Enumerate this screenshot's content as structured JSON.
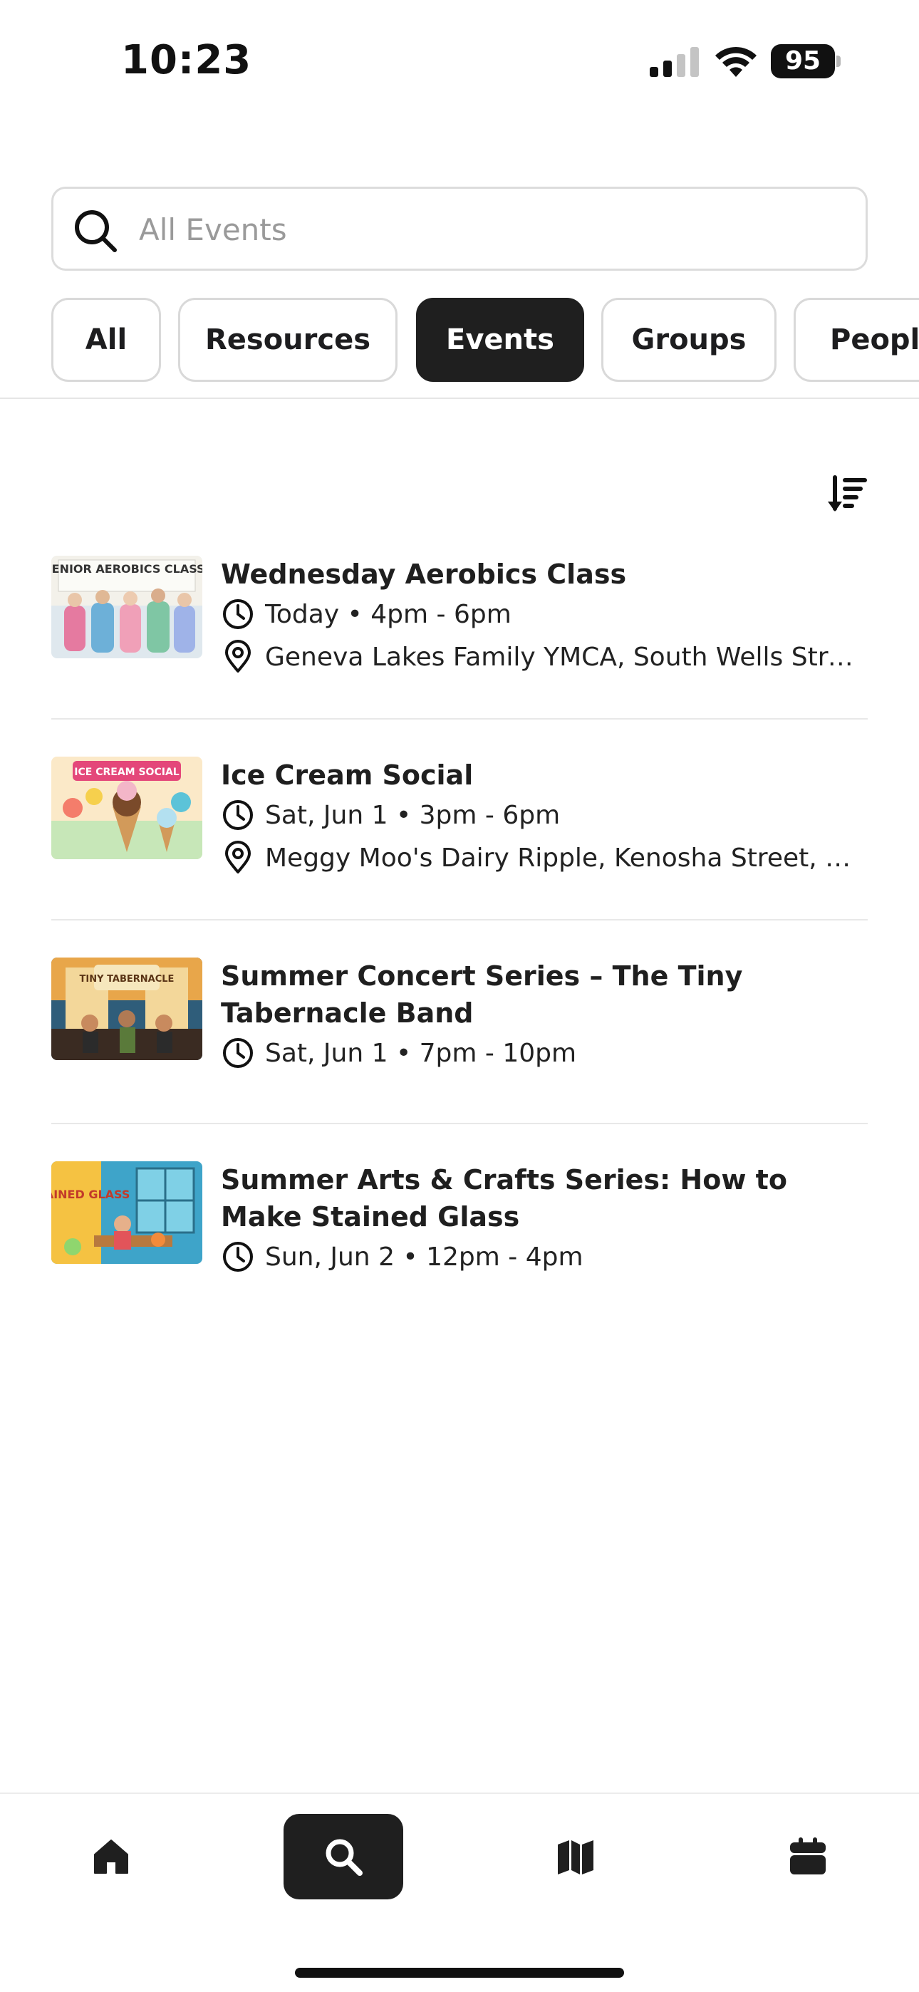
{
  "status_bar": {
    "time": "10:23",
    "battery": "95"
  },
  "search": {
    "placeholder": "All Events",
    "value": ""
  },
  "tabs": [
    {
      "label": "All",
      "active": false
    },
    {
      "label": "Resources",
      "active": false
    },
    {
      "label": "Events",
      "active": true
    },
    {
      "label": "Groups",
      "active": false
    },
    {
      "label": "People",
      "active": false
    }
  ],
  "sort": {
    "icon": "sort-descending-icon"
  },
  "events": [
    {
      "title": "Wednesday Aerobics Class",
      "time": "Today • 4pm - 6pm",
      "location": "Geneva Lakes Family YMCA, South Wells Street, Lake Geneva",
      "thumb_label": "SENIOR AEROBICS CLASS!"
    },
    {
      "title": "Ice Cream Social",
      "time": "Sat, Jun 1 • 3pm - 6pm",
      "location": "Meggy Moo's Dairy Ripple, Kenosha Street, Walworth",
      "thumb_label": "ICE CREAM SOCIAL"
    },
    {
      "title": "Summer Concert Series – The Tiny Tabernacle Band",
      "time": "Sat, Jun 1 • 7pm - 10pm",
      "thumb_label": "TINY TABERNACLE"
    },
    {
      "title": "Summer Arts & Crafts Series: How to Make Stained Glass",
      "time": "Sun, Jun 2 • 12pm - 4pm",
      "thumb_label": "STAINED GLASS"
    }
  ],
  "bottom_nav": [
    {
      "icon": "home-icon",
      "active": false
    },
    {
      "icon": "search-icon",
      "active": true
    },
    {
      "icon": "map-icon",
      "active": false
    },
    {
      "icon": "calendar-icon",
      "active": false
    }
  ],
  "colors": {
    "active_bg": "#1f1f1f",
    "border": "#d9d9d9",
    "placeholder": "#9a9a9a"
  }
}
